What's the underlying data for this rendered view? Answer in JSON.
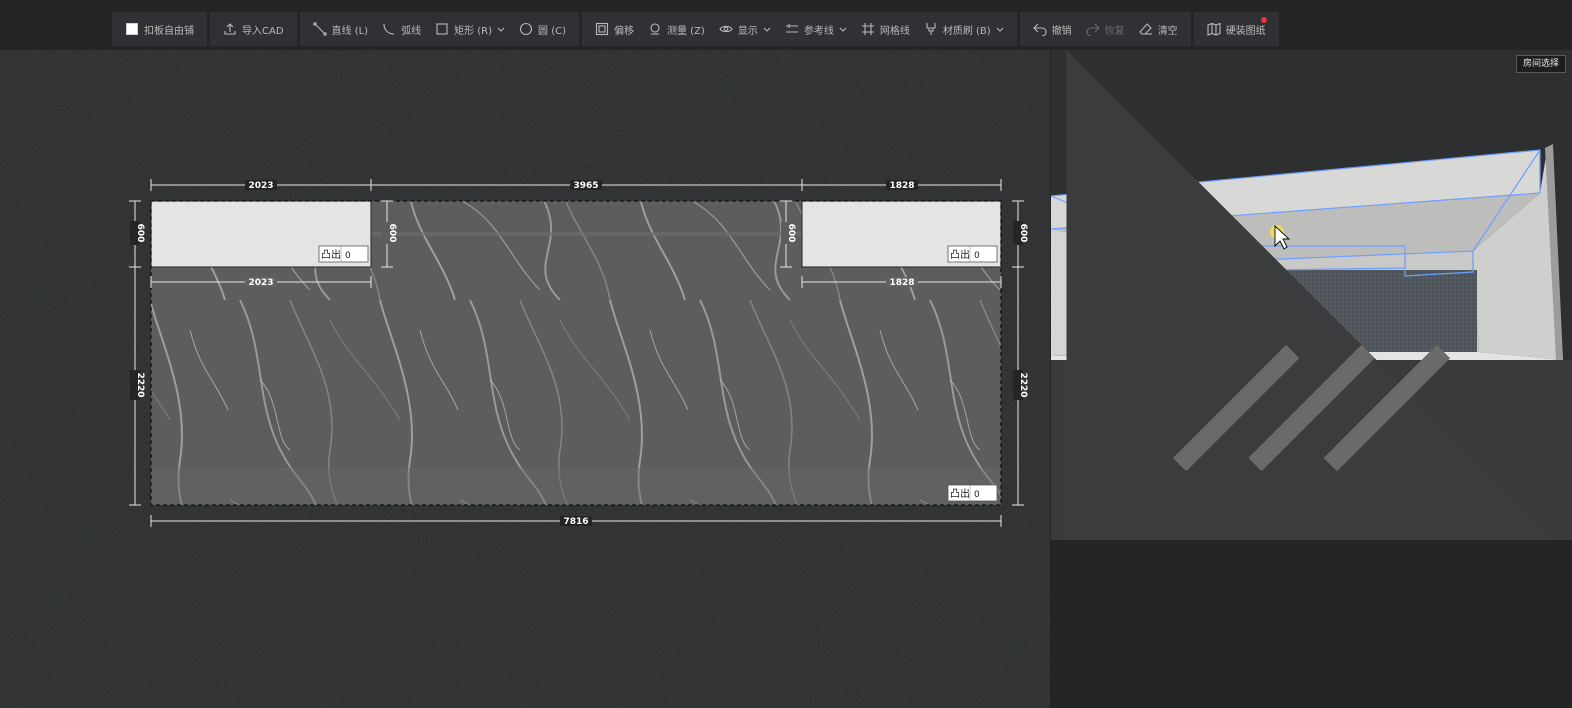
{
  "toolbar": {
    "free_tile": "扣板自由铺",
    "import_cad": "导入CAD",
    "line": "直线 (L)",
    "arc": "弧线",
    "rect": "矩形 (R)",
    "circle": "圆 (C)",
    "offset": "偏移",
    "measure": "测量 (Z)",
    "display": "显示",
    "guide": "参考线",
    "grid": "网格线",
    "material_brush": "材质刷 (B)",
    "undo": "撤销",
    "redo": "恢复",
    "clear": "清空",
    "drawing": "硬装图纸"
  },
  "preview": {
    "room_select": "房间选择"
  },
  "plan": {
    "top_dims": [
      "2023",
      "3965",
      "1828"
    ],
    "inner_dims": [
      "2023",
      "1828"
    ],
    "bottom_dim": "7816",
    "left_dims": [
      "600",
      "2220"
    ],
    "right_dims": [
      "600",
      "2220"
    ],
    "inner_vertical_dims": [
      "600",
      "600"
    ],
    "protrude_label": "凸出",
    "protrude_values": [
      "0",
      "0",
      "0"
    ]
  },
  "colors": {
    "bg": "#232527",
    "toolbar": "#2f3134",
    "accent_edge": "#6f9fff",
    "badge": "#e53a2e"
  }
}
